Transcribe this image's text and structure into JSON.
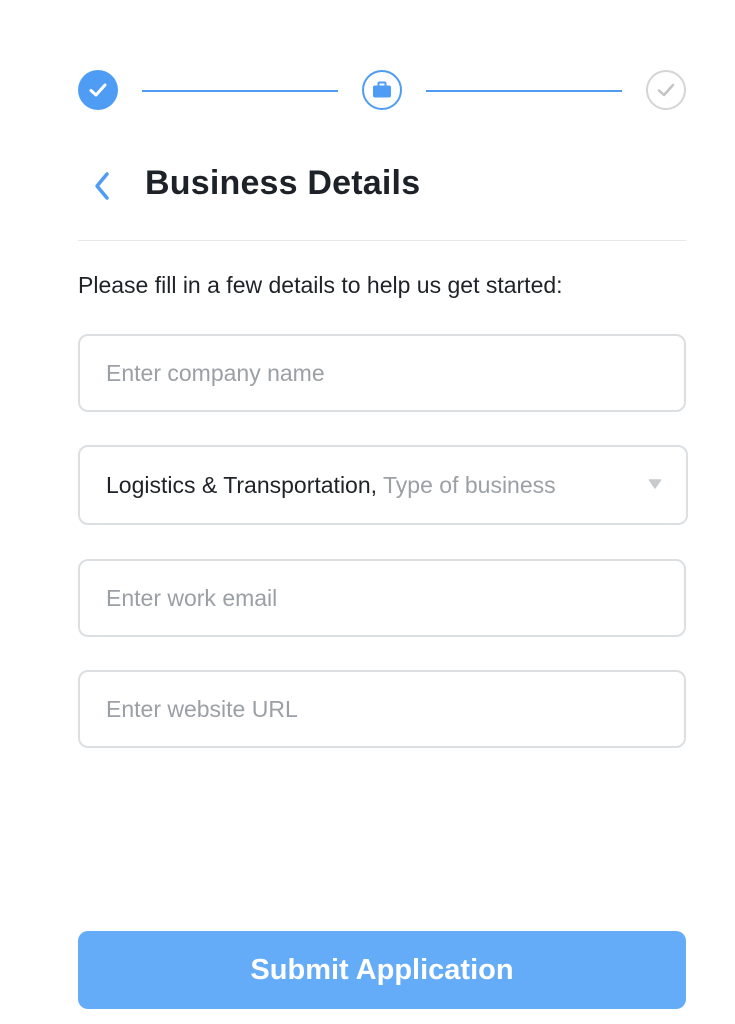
{
  "stepper": {
    "steps": [
      {
        "state": "completed",
        "icon": "check-icon"
      },
      {
        "state": "current",
        "icon": "briefcase-icon"
      },
      {
        "state": "upcoming",
        "icon": "check-icon"
      }
    ],
    "accent_color": "#4f9cf5",
    "inactive_color": "#d5d5d5"
  },
  "header": {
    "back_icon": "chevron-left-icon",
    "title": "Business Details"
  },
  "intro_text": "Please fill in a few details to help us get started:",
  "form": {
    "company_name": {
      "value": "",
      "placeholder": "Enter company name"
    },
    "business_type": {
      "selected_value": "Logistics & Transportation,",
      "placeholder": "Type of business",
      "icon": "caret-down-icon"
    },
    "work_email": {
      "value": "",
      "placeholder": "Enter work email"
    },
    "website_url": {
      "value": "",
      "placeholder": "Enter website URL"
    }
  },
  "submit": {
    "label": "Submit Application",
    "background_color": "#65acf8"
  }
}
